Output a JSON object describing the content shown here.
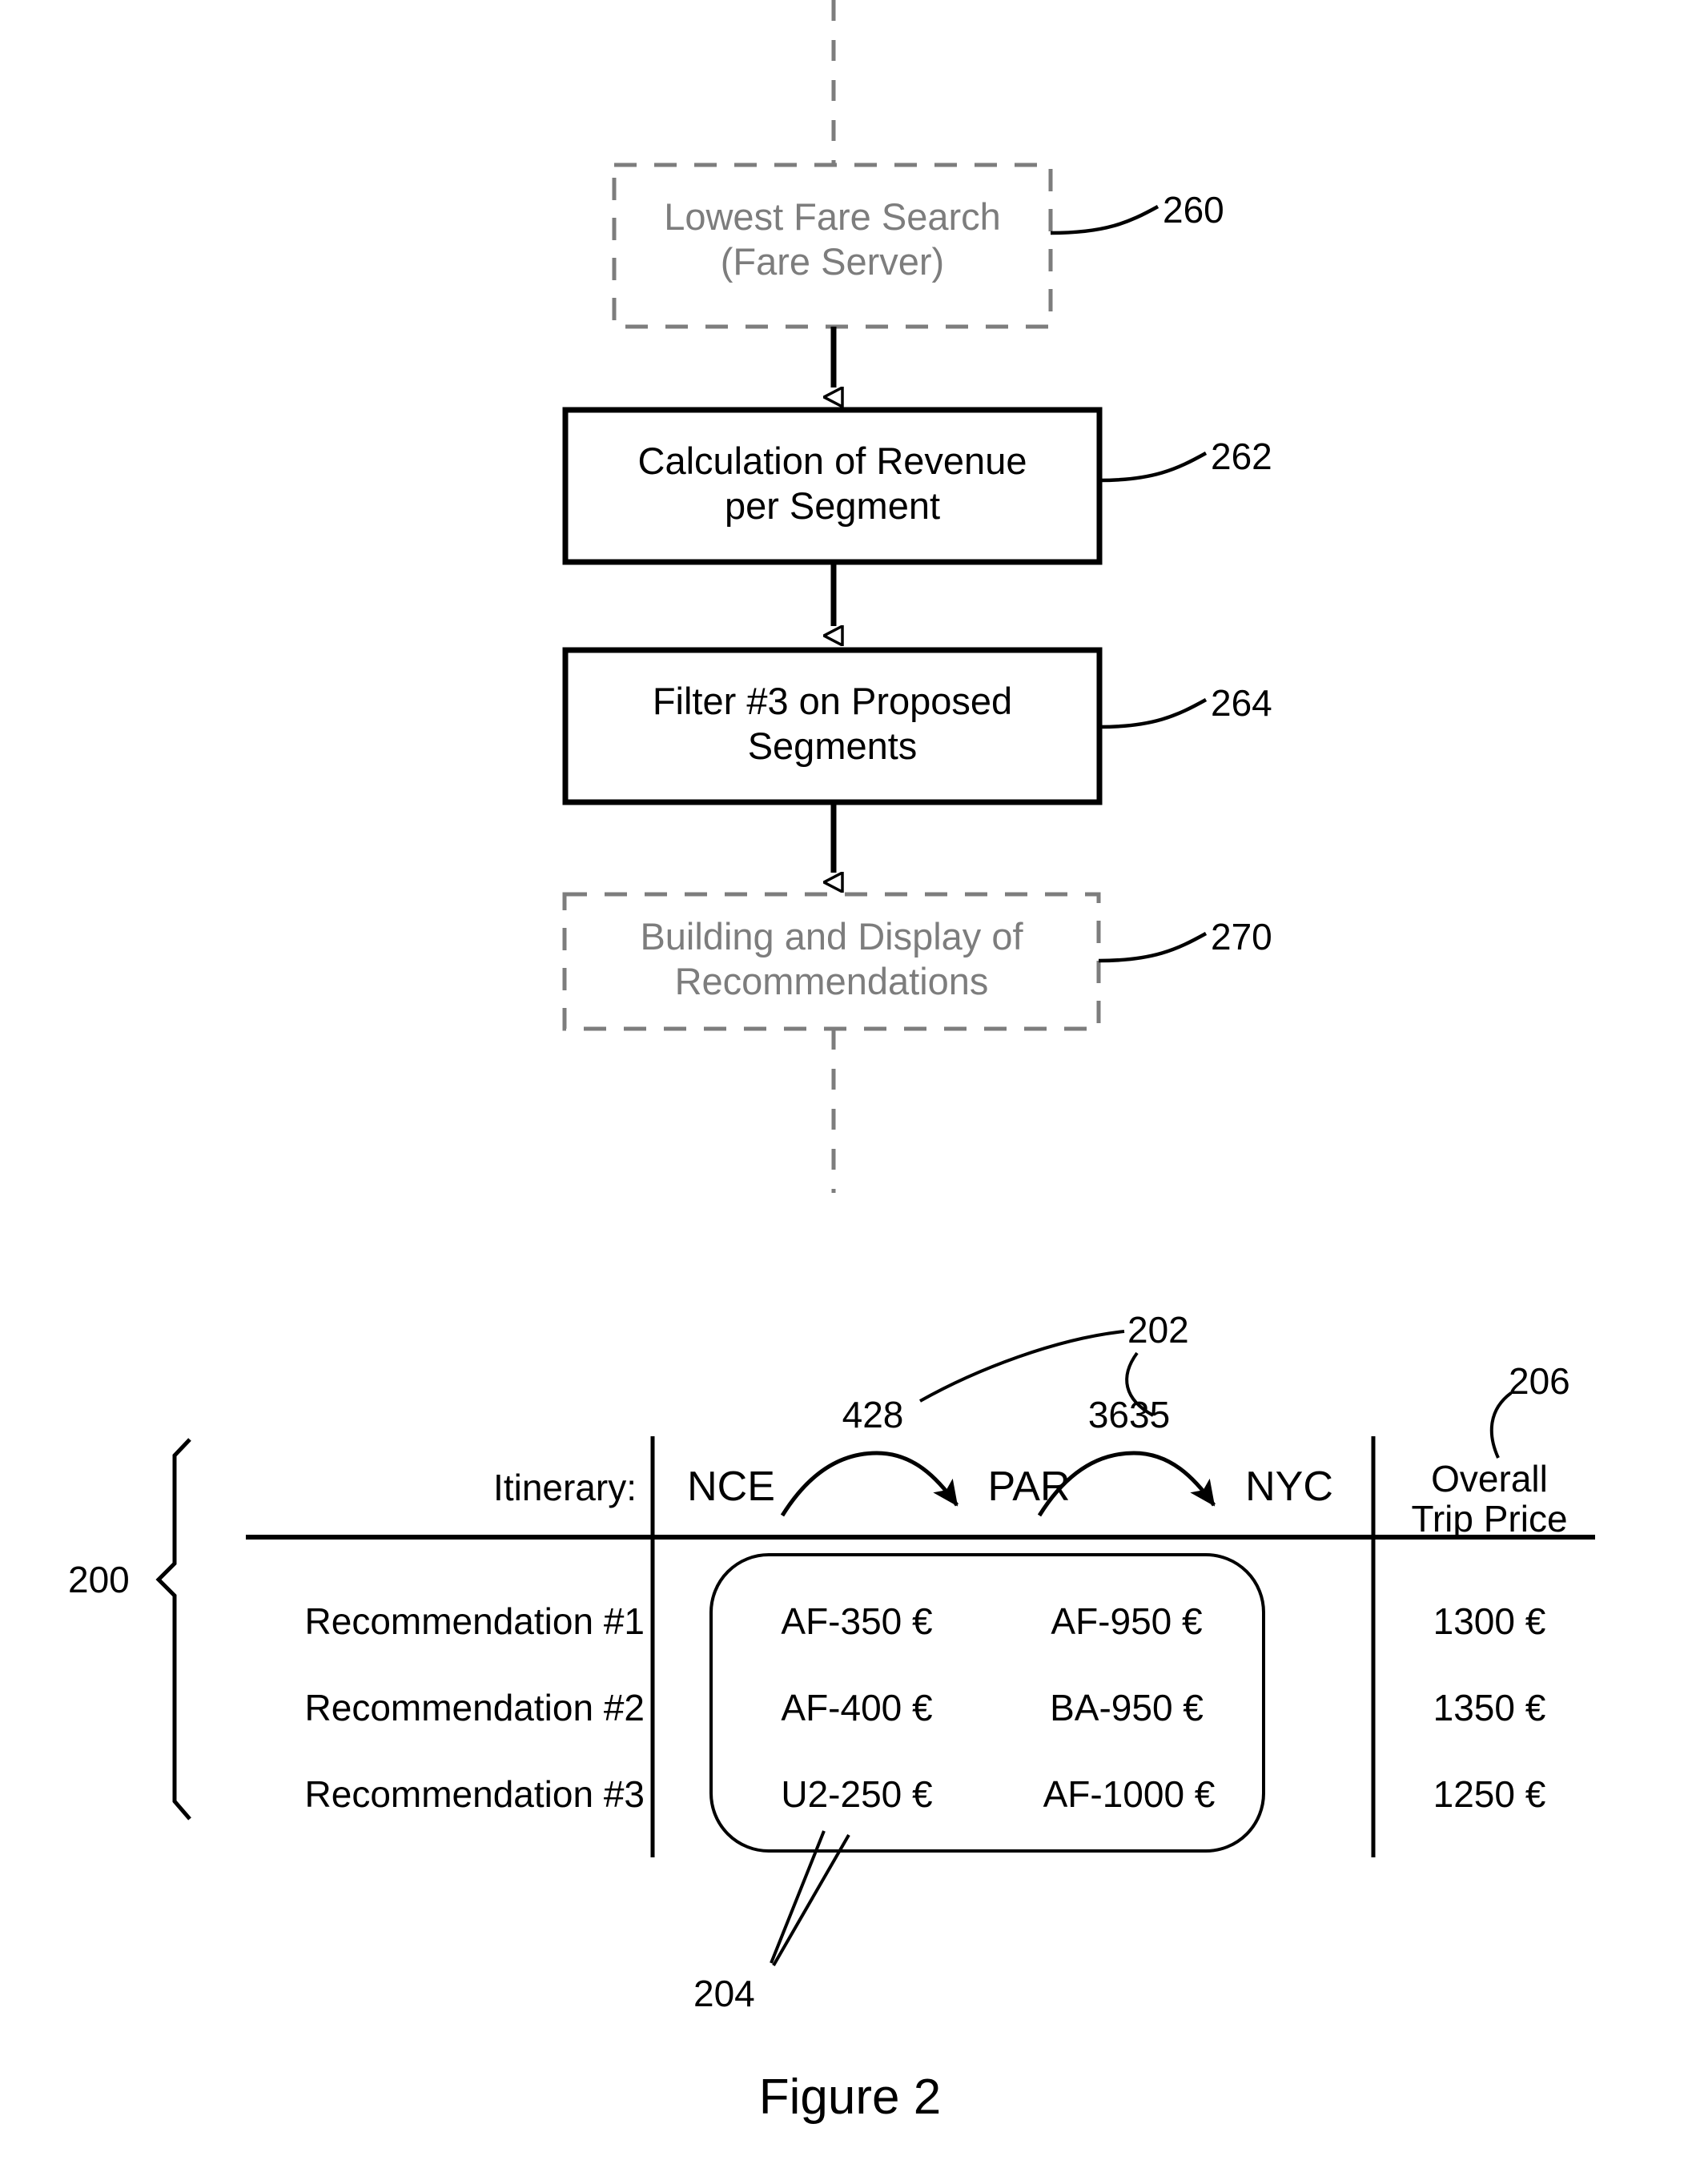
{
  "figure": {
    "caption": "Figure 2"
  },
  "flowchart": {
    "nodes": [
      {
        "id": "lowest-fare-search",
        "style": "dashed",
        "lines": [
          "Lowest Fare Search",
          "(Fare Server)"
        ],
        "ref": "260"
      },
      {
        "id": "calculation-of-revenue",
        "style": "solid",
        "lines": [
          "Calculation of Revenue",
          "per Segment"
        ],
        "ref": "262"
      },
      {
        "id": "filter-3",
        "style": "solid",
        "lines": [
          "Filter #3 on Proposed",
          "Segments"
        ],
        "ref": "264"
      },
      {
        "id": "building-display",
        "style": "dashed",
        "lines": [
          "Building and Display of",
          "Recommendations"
        ],
        "ref": "270"
      }
    ]
  },
  "table": {
    "brace_ref": "200",
    "itinerary_label": "Itinerary:",
    "cities": [
      "NCE",
      "PAR",
      "NYC"
    ],
    "segment_numbers": [
      "428",
      "3635"
    ],
    "segment_ref": "202",
    "fares_group_ref": "204",
    "price_header": [
      "Overall",
      "Trip Price"
    ],
    "price_header_ref": "206",
    "rows": [
      {
        "label": "Recommendation #1",
        "fares": [
          "AF-350 €",
          "AF-950 €"
        ],
        "total": "1300 €"
      },
      {
        "label": "Recommendation #2",
        "fares": [
          "AF-400 €",
          "BA-950 €"
        ],
        "total": "1350 €"
      },
      {
        "label": "Recommendation #3",
        "fares": [
          "U2-250 €",
          "AF-1000 €"
        ],
        "total": "1250 €"
      }
    ]
  },
  "colors": {
    "ink": "#000000",
    "dashed_box_ink": "#7d7d7d"
  }
}
